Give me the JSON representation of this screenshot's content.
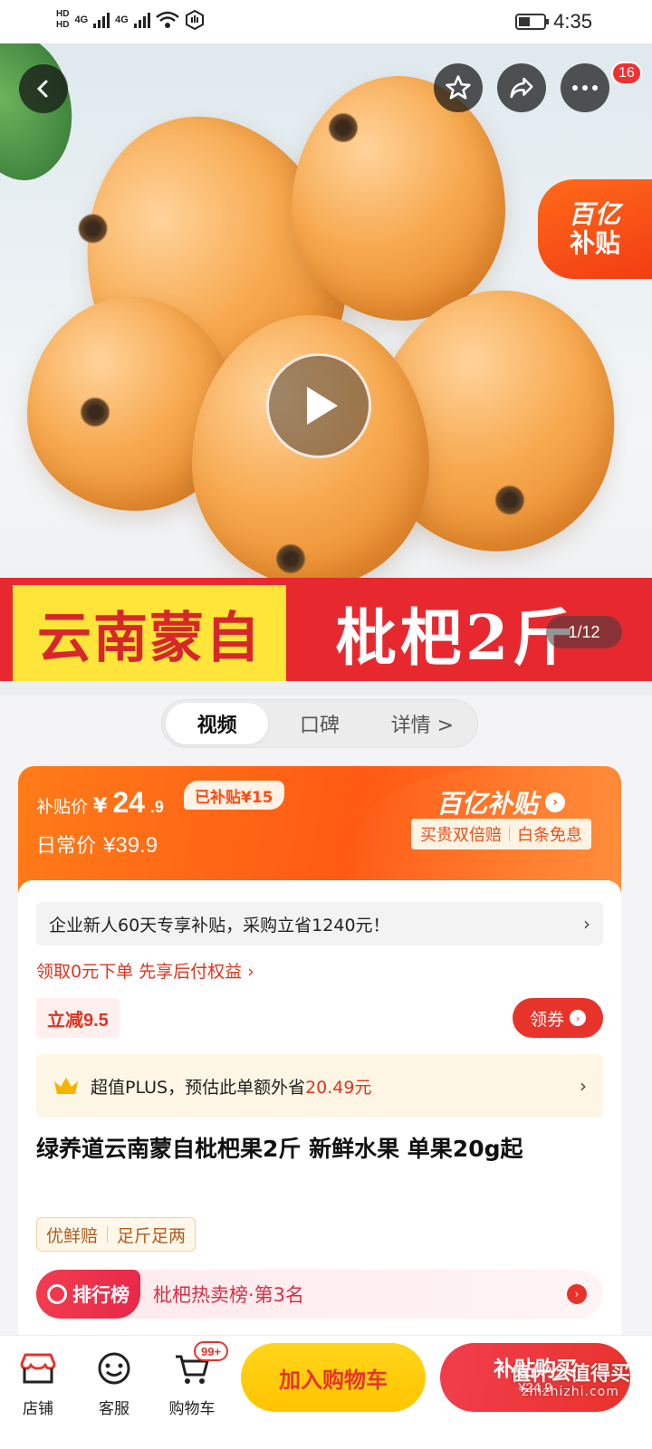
{
  "status_bar": {
    "hd1": "HD",
    "hd2": "HD",
    "net1": "4G",
    "net2": "4G",
    "time": "4:35"
  },
  "hero": {
    "subsidy_tag_line1": "百亿",
    "subsidy_tag_line2": "补贴",
    "cart_badge": "16",
    "banner_left": "云南蒙自",
    "banner_right": "枇杷2斤",
    "pager": "1/12"
  },
  "tabs": [
    "视频",
    "口碑",
    "详情 >"
  ],
  "price": {
    "subsidy_label": "补贴价",
    "currency": "¥",
    "subsidy_int": "24",
    "subsidy_dec": ".9",
    "saved_badge": "已补贴¥15",
    "daily_label": "日常价",
    "daily_value": "¥39.9",
    "brand": "百亿补贴",
    "guarantee_1": "买贵双倍赔",
    "guarantee_2": "白条免息"
  },
  "body": {
    "newbie": "企业新人60天专享补贴，采购立省1240元！",
    "pay_after": "领取0元下单 先享后付权益 ›",
    "discount": "立减9.5",
    "coupon": "领券",
    "plus_text": "超值PLUS，预估此单额外省",
    "plus_amount": "20.49元",
    "title": "绿养道云南蒙自枇杷果2斤 新鲜水果 单果20g起",
    "tag1": "优鲜赔",
    "tag2": "足斤足两",
    "rank_label": "排行榜",
    "rank_text": "枇杷热卖榜·第3名"
  },
  "bottom": {
    "store": "店铺",
    "service": "客服",
    "cart": "购物车",
    "cart_badge": "99+",
    "add_cart": "加入购物车",
    "buy_line1": "补贴购买",
    "buy_line2": "¥24.9",
    "watermark_line1": "值什么值得买",
    "watermark_line2": "zhizhizhi.com"
  },
  "colors": {
    "accent_red": "#e8332b",
    "subsidy_orange": "#ff5a14",
    "cart_yellow": "#ffc400"
  }
}
